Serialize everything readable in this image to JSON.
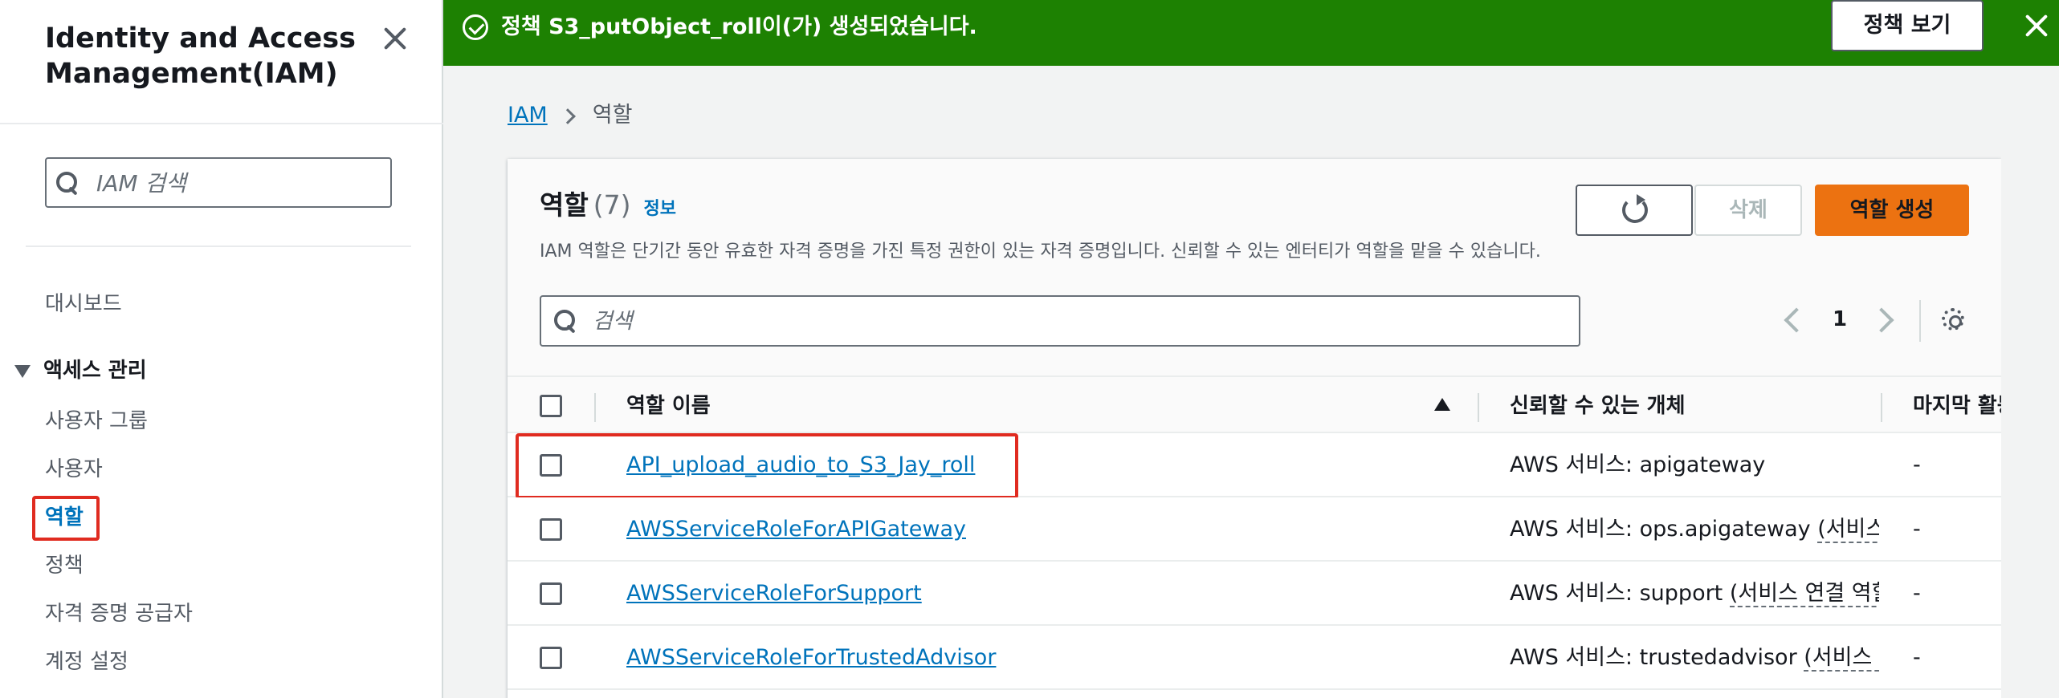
{
  "sidebar": {
    "title": "Identity and Access Management(IAM)",
    "search_placeholder": "IAM 검색",
    "nav": {
      "dashboard": "대시보드",
      "access_management": "액세스 관리",
      "user_groups": "사용자 그룹",
      "users": "사용자",
      "roles": "역할",
      "policies": "정책",
      "identity_providers": "자격 증명 공급자",
      "account_settings": "계정 설정"
    },
    "active_item": "역할"
  },
  "flash": {
    "message": "정책 S3_putObject_roll이(가) 생성되었습니다.",
    "button": "정책 보기",
    "color": "#1d8102"
  },
  "breadcrumb": {
    "root": "IAM",
    "current": "역할"
  },
  "roles_panel": {
    "title": "역할",
    "count": "(7)",
    "info": "정보",
    "description": "IAM 역할은 단기간 동안 유효한 자격 증명을 가진 특정 권한이 있는 자격 증명입니다. 신뢰할 수 있는 엔터티가 역할을 맡을 수 있습니다.",
    "buttons": {
      "delete": "삭제",
      "create": "역할 생성"
    },
    "search_placeholder": "검색",
    "pagination": {
      "current_page": "1"
    },
    "columns": {
      "role_name": "역할 이름",
      "trusted_entity": "신뢰할 수 있는 개체",
      "last_activity": "마지막 활동"
    },
    "rows": [
      {
        "name": "API_upload_audio_to_S3_Jay_roll",
        "entity_prefix": "AWS 서비스: apigateway",
        "entity_link": "",
        "last": "-"
      },
      {
        "name": "AWSServiceRoleForAPIGateway",
        "entity_prefix": "AWS 서비스: ops.apigateway",
        "entity_link": "(서비스 연결 역할)",
        "last": "-"
      },
      {
        "name": "AWSServiceRoleForSupport",
        "entity_prefix": "AWS 서비스: support",
        "entity_link": "(서비스 연결 역할)",
        "last": "-"
      },
      {
        "name": "AWSServiceRoleForTrustedAdvisor",
        "entity_prefix": "AWS 서비스: trustedadvisor",
        "entity_link": "(서비스 연결 역할)",
        "last": "-"
      }
    ],
    "accent_color": "#ec7211",
    "link_color": "#0073bb",
    "highlight_color": "#e02b20"
  }
}
